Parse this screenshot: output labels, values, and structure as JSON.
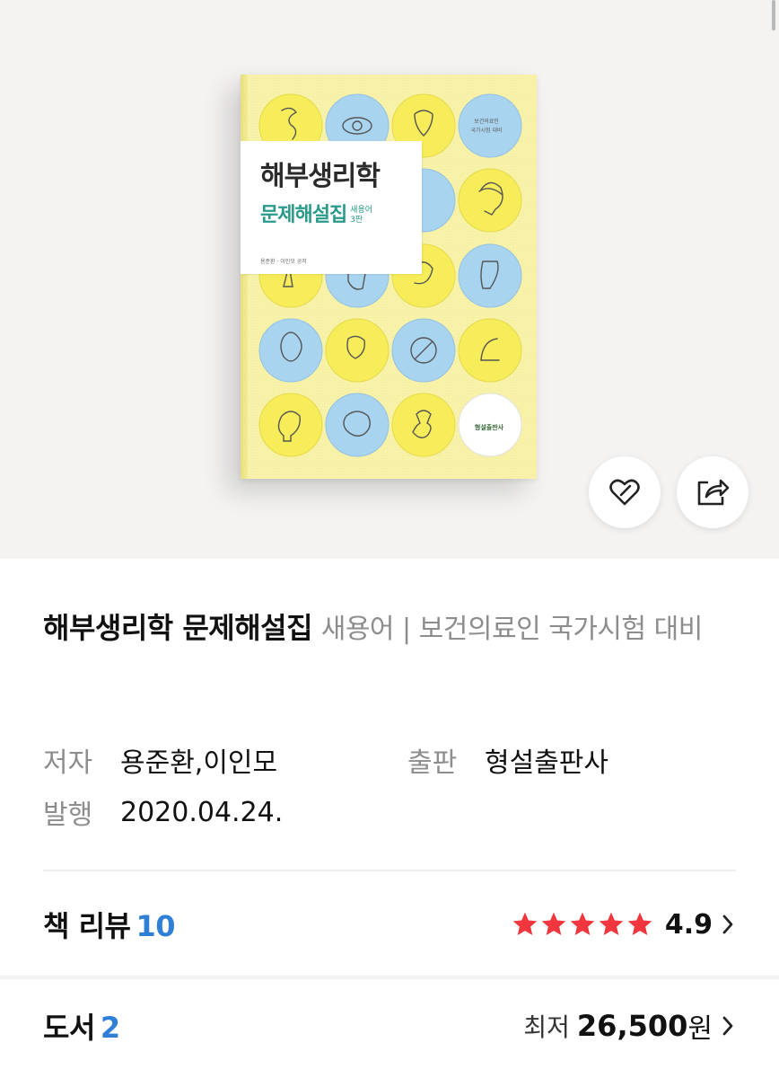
{
  "book": {
    "title": "해부생리학 문제해설집",
    "subtitle": "새용어 | 보건의료인 국가시험 대비",
    "author_label": "저자",
    "author": "용준환,이인모",
    "publisher_label": "출판",
    "publisher": "형설출판사",
    "published_label": "발행",
    "published": "2020.04.24."
  },
  "cover": {
    "title": "해부생리학",
    "subtitle": "문제해설집",
    "edition_line1": "새용어",
    "edition_line2": "3판",
    "exam_line1": "보건의료인",
    "exam_line2": "국가시험 대비",
    "authors": "용준환 · 이인모 공저",
    "publisher": "형설출판사",
    "colors": {
      "background": "#f8f3a8",
      "yellow": "#f7ec5a",
      "blue": "#a9d4f0",
      "accent": "#2a9a8a"
    }
  },
  "actions": {
    "like_icon": "heart-icon",
    "share_icon": "share-icon"
  },
  "review": {
    "label": "책 리뷰",
    "count": "10",
    "rating": "4.9",
    "stars": 5,
    "star_color": "#f0373f"
  },
  "books": {
    "label": "도서",
    "count": "2",
    "price_prefix": "최저",
    "price": "26,500",
    "price_unit": "원"
  }
}
